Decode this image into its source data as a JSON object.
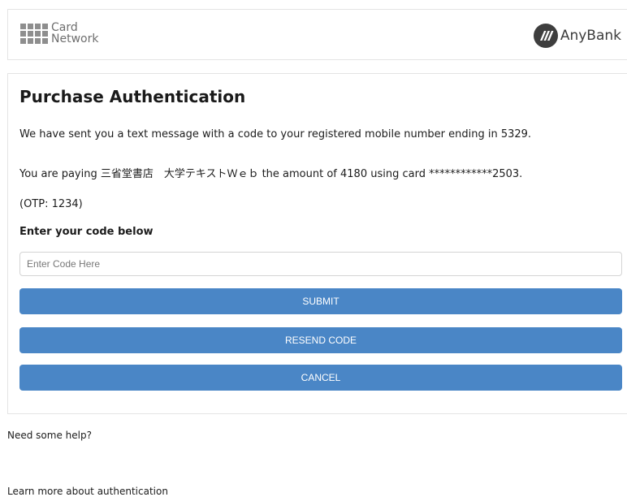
{
  "header": {
    "network_name_line1": "Card",
    "network_name_line2": "Network",
    "bank_name": "AnyBank"
  },
  "auth": {
    "title": "Purchase Authentication",
    "sent_message": "We have sent you a text message with a code to your registered mobile number ending in 5329.",
    "payment_message": "You are paying 三省堂書店　大学テキストＷｅｂ the amount of 4180 using card ************2503.",
    "otp_hint": "(OTP: 1234)",
    "code_label": "Enter your code below",
    "code_placeholder": "Enter Code Here",
    "code_value": "",
    "submit_label": "SUBMIT",
    "resend_label": "RESEND CODE",
    "cancel_label": "CANCEL"
  },
  "footer": {
    "help_link": "Need some help?",
    "learn_more_link": "Learn more about authentication"
  },
  "colors": {
    "button_bg": "#4a86c6",
    "button_text": "#ffffff",
    "border": "#e4e4e4"
  }
}
